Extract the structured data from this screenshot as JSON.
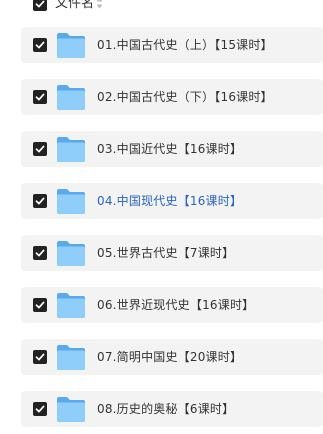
{
  "header": {
    "column_label": "文件名"
  },
  "files": [
    {
      "name": "01.中国古代史（上）【15课时】",
      "checked": true
    },
    {
      "name": "02.中国古代史（下）【16课时】",
      "checked": true
    },
    {
      "name": "03.中国近代史【16课时】",
      "checked": true
    },
    {
      "name": "04.中国现代史【16课时】",
      "checked": true,
      "highlight_color": "#2a64c4"
    },
    {
      "name": "05.世界古代史【7课时】",
      "checked": true
    },
    {
      "name": "06.世界近现代史【16课时】",
      "checked": true
    },
    {
      "name": "07.简明中国史【20课时】",
      "checked": true
    },
    {
      "name": "08.历史的奥秘【6课时】",
      "checked": true
    }
  ],
  "colors": {
    "row_bg": "#f3f3f3",
    "checkbox": "#222222",
    "folder": "#6ab4f2",
    "text": "#333333",
    "highlight_text": "#2a64c4"
  },
  "icons": {
    "checkbox": "checkbox-checked-icon",
    "folder": "folder-icon",
    "sort": "sort-arrows-icon"
  }
}
